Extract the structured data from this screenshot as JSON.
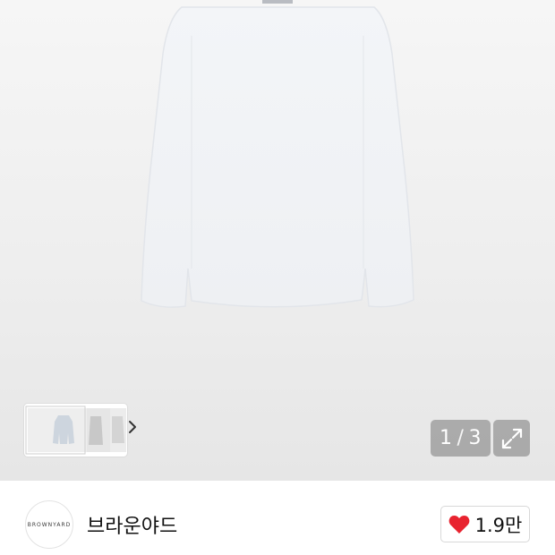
{
  "product_gallery": {
    "page_indicator": {
      "current": "1",
      "separator": "/",
      "total": "3"
    },
    "thumbnails": {
      "count": 3,
      "next_icon": "chevron-right-icon"
    },
    "expand_icon": "expand-arrows-icon"
  },
  "brand": {
    "logo_text": "BROWNYARD",
    "name": "브라운야드"
  },
  "like": {
    "icon": "heart-icon",
    "count": "1.9만",
    "color": "#e8232f"
  },
  "colors": {
    "shirt": "#f0f2f5",
    "background": "#efefef"
  }
}
